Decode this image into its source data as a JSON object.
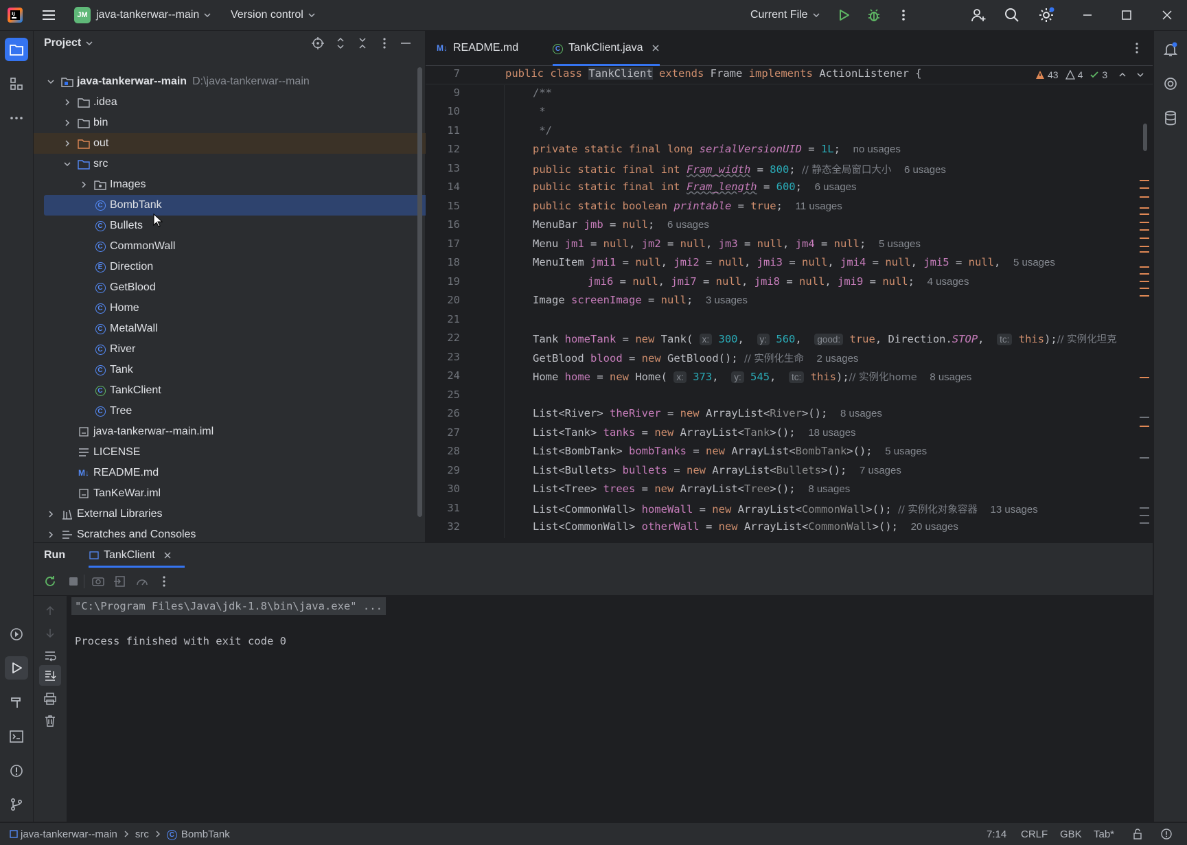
{
  "titlebar": {
    "project_badge": "JM",
    "project_name": "java-tankerwar--main",
    "vcs_label": "Version control",
    "run_config": "Current File"
  },
  "project_panel": {
    "title": "Project",
    "root_name": "java-tankerwar--main",
    "root_path": "D:\\java-tankerwar--main",
    "items": [
      {
        "label": ".idea"
      },
      {
        "label": "bin"
      },
      {
        "label": "out"
      },
      {
        "label": "src"
      },
      {
        "label": "Images"
      },
      {
        "label": "BombTank"
      },
      {
        "label": "Bullets"
      },
      {
        "label": "CommonWall"
      },
      {
        "label": "Direction"
      },
      {
        "label": "GetBlood"
      },
      {
        "label": "Home"
      },
      {
        "label": "MetalWall"
      },
      {
        "label": "River"
      },
      {
        "label": "Tank"
      },
      {
        "label": "TankClient"
      },
      {
        "label": "Tree"
      },
      {
        "label": "java-tankerwar--main.iml"
      },
      {
        "label": "LICENSE"
      },
      {
        "label": "README.md"
      },
      {
        "label": "TanKeWar.iml"
      },
      {
        "label": "External Libraries"
      },
      {
        "label": "Scratches and Consoles"
      }
    ]
  },
  "editor": {
    "tabs": [
      {
        "label": "README.md",
        "badge": "M↓"
      },
      {
        "label": "TankClient.java"
      }
    ],
    "inspections": {
      "warnings_a": "43",
      "warnings_b": "4",
      "ok": "3"
    },
    "line_numbers": [
      "7",
      "9",
      "10",
      "11",
      "12",
      "13",
      "14",
      "15",
      "16",
      "17",
      "18",
      "19",
      "20",
      "21",
      "22",
      "23",
      "24",
      "25",
      "26",
      "27",
      "28",
      "29",
      "30",
      "31",
      "32"
    ],
    "usages": {
      "l12": "no usages",
      "l13": "6 usages",
      "l14": "6 usages",
      "l15": "11 usages",
      "l16": "6 usages",
      "l17": "5 usages",
      "l18": "5 usages",
      "l19": "4 usages",
      "l20": "3 usages",
      "l23": "2 usages",
      "l24": "8 usages",
      "l26": "8 usages",
      "l27": "18 usages",
      "l28": "5 usages",
      "l29": "7 usages",
      "l30": "8 usages",
      "l31": "13 usages",
      "l32": "20 usages"
    },
    "comments": {
      "l13": "// 静态全局窗口大小",
      "l22": "// 实例化坦克",
      "l23": "// 实例化生命",
      "l24": "// 实例化home",
      "l31": "// 实例化对象容器"
    }
  },
  "run_panel": {
    "title": "Run",
    "tab_label": "TankClient",
    "console_lines": [
      "\"C:\\Program Files\\Java\\jdk-1.8\\bin\\java.exe\" ...",
      "Process finished with exit code 0"
    ]
  },
  "statusbar": {
    "crumbs": [
      "java-tankerwar--main",
      "src",
      "BombTank"
    ],
    "position": "7:14",
    "line_sep": "CRLF",
    "encoding": "GBK",
    "indent": "Tab*"
  }
}
